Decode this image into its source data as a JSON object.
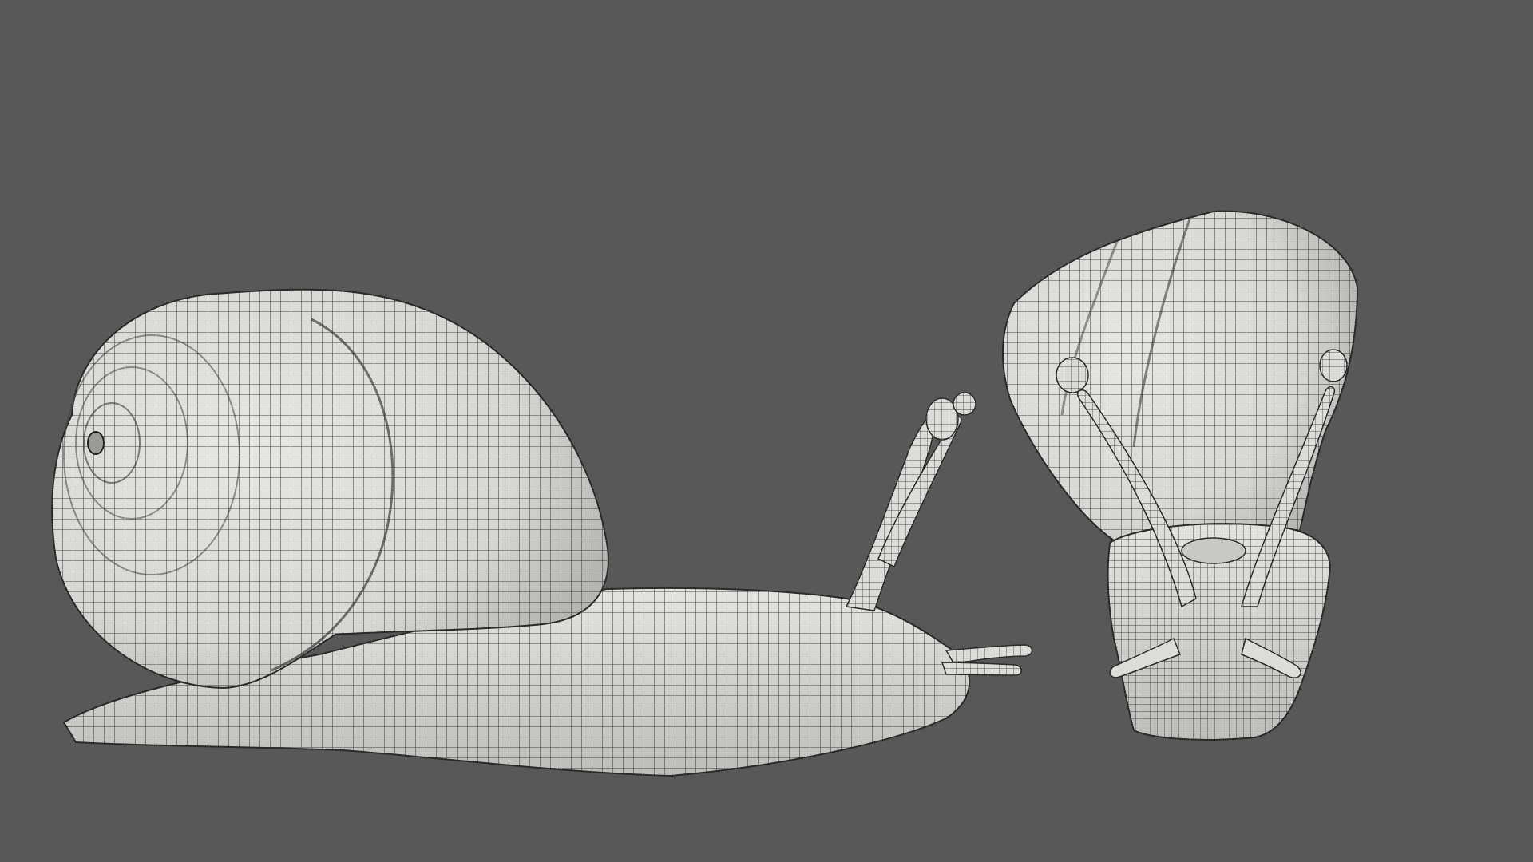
{
  "scene": {
    "background_color": "#585858",
    "mesh_fill_color": "#d9d9d6",
    "mesh_shade_color": "#b9b9b6",
    "wire_color": "#2a2a2a",
    "objects": [
      {
        "name": "snail-side-view",
        "view": "side"
      },
      {
        "name": "snail-front-view",
        "view": "front"
      }
    ]
  }
}
